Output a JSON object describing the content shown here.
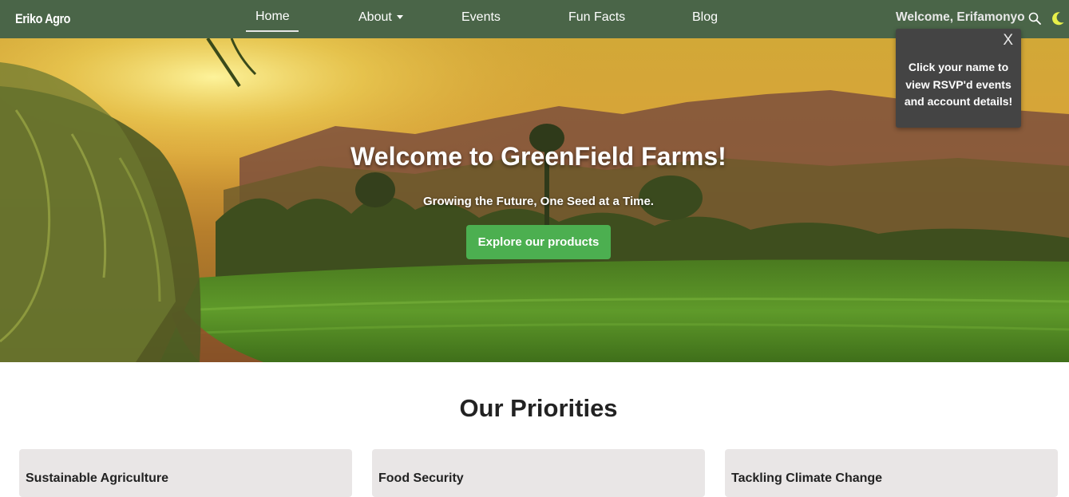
{
  "navbar": {
    "brand": "Eriko Agro",
    "links": [
      {
        "label": "Home"
      },
      {
        "label": "About"
      },
      {
        "label": "Events"
      },
      {
        "label": "Fun Facts"
      },
      {
        "label": "Blog"
      }
    ],
    "welcome": "Welcome, Erifamonyo",
    "icons": [
      "search-icon",
      "moon-icon"
    ],
    "color": "#4a6548"
  },
  "tooltip": {
    "close_label": "X",
    "text": "Click your name to view RSVP'd events and account details!"
  },
  "hero": {
    "title": "Welcome to GreenField Farms!",
    "subtitle": "Growing the Future, One Seed at a Time.",
    "button_label": "Explore our products",
    "button_color": "#4caf50"
  },
  "priorities": {
    "title": "Our Priorities",
    "cards": [
      {
        "title": "Sustainable Agriculture"
      },
      {
        "title": "Food Security"
      },
      {
        "title": "Tackling Climate Change"
      }
    ]
  }
}
